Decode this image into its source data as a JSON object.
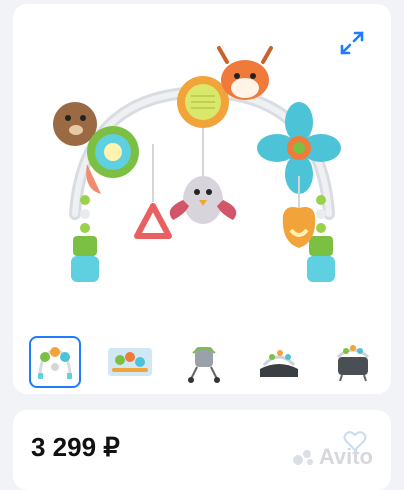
{
  "listing": {
    "price": "3 299 ₽",
    "watermark_text": "Avito"
  },
  "gallery": {
    "thumbnail_count": 5,
    "active_index": 0
  },
  "colors": {
    "accent": "#1f7cff",
    "background": "#f2f3f7"
  },
  "icons": {
    "expand": "expand-arrows-icon",
    "favorite": "heart-outline-icon"
  }
}
